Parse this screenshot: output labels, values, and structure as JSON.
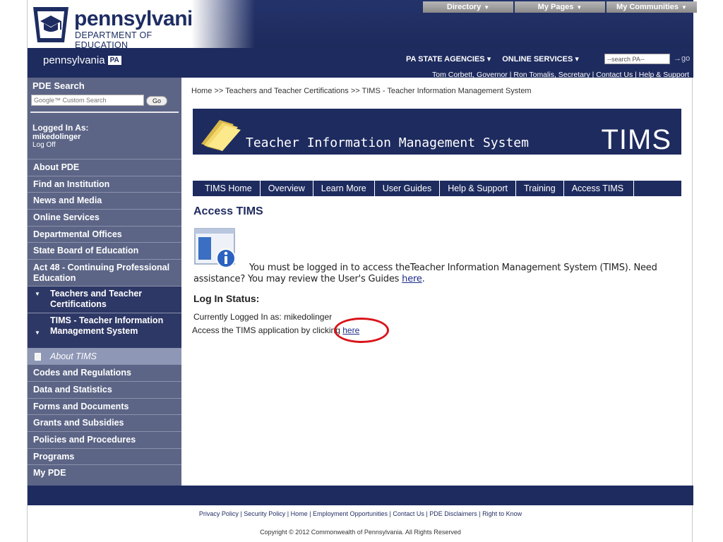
{
  "header": {
    "logo_name": "pennsylvania",
    "logo_sub": "DEPARTMENT OF EDUCATION",
    "top_menu": [
      "Directory",
      "My Pages",
      "My Communities"
    ]
  },
  "navbar": {
    "brand": "pennsylvania",
    "brand_badge": "PA",
    "agency_menu": "PA STATE AGENCIES",
    "services_menu": "ONLINE SERVICES",
    "search_value": "--search PA--",
    "go_label": "go",
    "governor": "Tom Corbett, Governor",
    "secretary": "Ron Tomalis, Secretary",
    "contact": "Contact Us",
    "help": "Help & Support"
  },
  "sidebar": {
    "search_title": "PDE Search",
    "search_placeholder": "Google™ Custom Search",
    "search_go": "Go",
    "login_label": "Logged In As:",
    "login_user": "mikedolinger",
    "logoff": "Log Off",
    "items": [
      "About PDE",
      "Find an Institution",
      "News and Media",
      "Online Services",
      "Departmental Offices",
      "State Board of Education",
      "Act 48 - Continuing Professional Education",
      "Teachers and Teacher Certifications",
      "TIMS - Teacher Information Management System",
      "About TIMS",
      "Codes and Regulations",
      "Data and Statistics",
      "Forms and Documents",
      "Grants and Subsidies",
      "Policies and Procedures",
      "Programs",
      "My PDE"
    ]
  },
  "main": {
    "breadcrumb": "Home >> Teachers and Teacher Certifications >> TIMS - Teacher Information Management System",
    "banner_title": "Teacher Information Management System",
    "banner_abbr": "TIMS",
    "tabs": [
      "TIMS Home",
      "Overview",
      "Learn More",
      "User Guides",
      "Help & Support",
      "Training",
      "Access TIMS"
    ],
    "page_title": "Access TIMS",
    "msg_line1": "You must be logged in to access theTeacher Information Management System (TIMS). Need",
    "msg_line2_prefix": "assistance? You may review the User's Guides",
    "msg_link": "here",
    "msg_line2_suffix": ".",
    "status_title": "Log In Status:",
    "logged_line": "Currently Logged In as: mikedolinger",
    "access_prefix": "Access the TIMS application by clicking",
    "access_link": "here"
  },
  "footer": {
    "links": [
      "Privacy Policy",
      "Security Policy",
      "Home",
      "Employment Opportunities",
      "Contact Us",
      "PDE Disclaimers",
      "Right to Know"
    ],
    "copyright": "Copyright © 2012 Commonwealth of Pennsylvania. All Rights Reserved"
  },
  "colors": {
    "navy": "#1e2b5f",
    "sidebar": "#5c6586",
    "highlight_oval": "#d9141b"
  }
}
